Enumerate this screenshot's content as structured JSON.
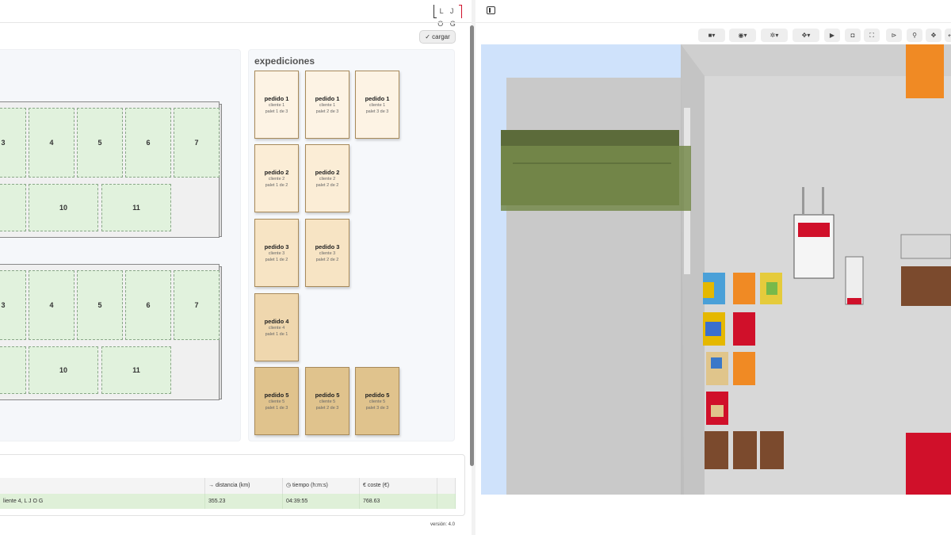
{
  "header": {
    "logo_text": "L J O G"
  },
  "toolbar_left": {
    "cargar_label": "✓ cargar"
  },
  "trucks": [
    {
      "row1": [
        "3",
        "4",
        "5",
        "6",
        "7"
      ],
      "row2": [
        "10",
        "11"
      ]
    },
    {
      "row1": [
        "3",
        "4",
        "5",
        "6",
        "7"
      ],
      "row2": [
        "10",
        "11"
      ]
    }
  ],
  "expediciones": {
    "title": "expediciones",
    "cards": [
      {
        "title": "pedido 1",
        "client": "cliente 1",
        "pallet": "palet 1 de 3",
        "color": "#fdf3e4"
      },
      {
        "title": "pedido 1",
        "client": "cliente 1",
        "pallet": "palet 2 de 3",
        "color": "#fdf3e4"
      },
      {
        "title": "pedido 1",
        "client": "cliente 1",
        "pallet": "palet 3 de 3",
        "color": "#fdf3e4"
      },
      {
        "title": "pedido 2",
        "client": "cliente 2",
        "pallet": "palet 1 de 2",
        "color": "#fbedd6"
      },
      {
        "title": "pedido 2",
        "client": "cliente 2",
        "pallet": "palet 2 de 2",
        "color": "#fbedd6"
      },
      {
        "title": "pedido 3",
        "client": "cliente 3",
        "pallet": "palet 1 de 2",
        "color": "#f7e4c4"
      },
      {
        "title": "pedido 3",
        "client": "cliente 3",
        "pallet": "palet 2 de 2",
        "color": "#f7e4c4"
      },
      {
        "title": "pedido 4",
        "client": "cliente 4",
        "pallet": "palet 1 de 1",
        "color": "#efd7ae"
      },
      {
        "title": "pedido 5",
        "client": "cliente 5",
        "pallet": "palet 1 de 3",
        "color": "#e0c38d"
      },
      {
        "title": "pedido 5",
        "client": "cliente 5",
        "pallet": "palet 2 de 3",
        "color": "#e0c38d"
      },
      {
        "title": "pedido 5",
        "client": "cliente 5",
        "pallet": "palet 3 de 3",
        "color": "#e0c38d"
      }
    ]
  },
  "table": {
    "headers": [
      "→ distancia (km)",
      "◷ tiempo (h:m:s)",
      "€ coste (€)"
    ],
    "row": {
      "route": "liente 4, L J O G",
      "distance": "355.23",
      "time": "04:39:55",
      "cost": "768.63"
    }
  },
  "footer": {
    "version": "versión: 4.0"
  },
  "viewer_toolbar": [
    "■▾",
    "◉▾",
    "✲▾",
    "✥▾",
    "▶",
    "◘",
    "⛶",
    "⊳",
    "⚲",
    "✥",
    "⟷"
  ],
  "colors": {
    "accent": "#d0102a",
    "slot_green": "#e1f2dd",
    "sky": "#cfe2fb",
    "floor": "#d6d6d6"
  }
}
